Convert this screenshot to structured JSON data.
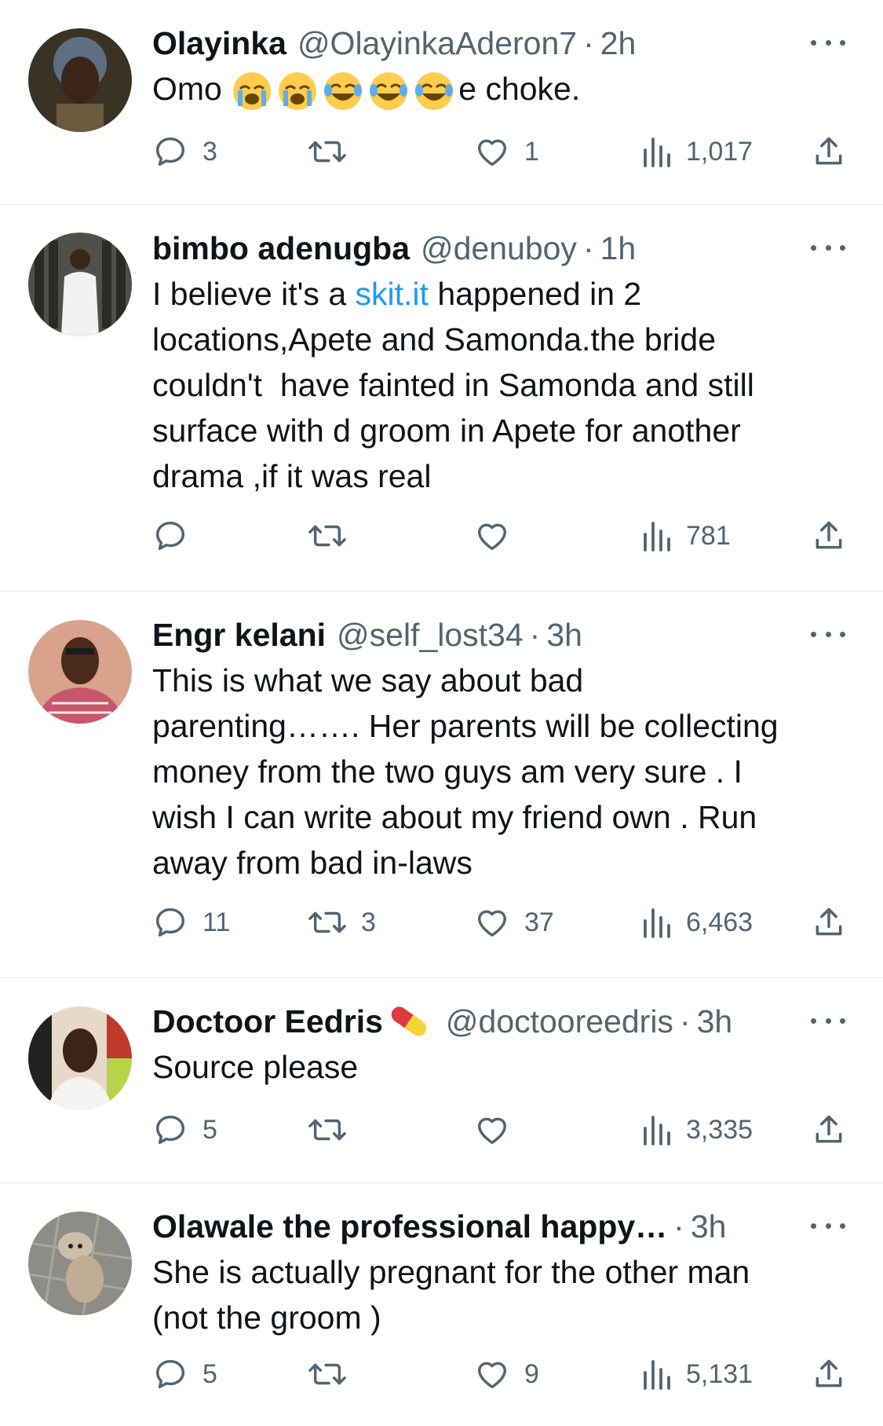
{
  "tweets": [
    {
      "name": "Olayinka",
      "handle": "@OlayinkaAderon7",
      "time": "2h",
      "text_pre": "Omo ",
      "emojis": [
        "loudly-crying-face",
        "loudly-crying-face",
        "face-with-tears-of-joy",
        "face-with-tears-of-joy",
        "face-with-tears-of-joy"
      ],
      "text_post": "e choke.",
      "replies": "3",
      "retweets": "",
      "likes": "1",
      "views": "1,017"
    },
    {
      "name": "bimbo adenugba",
      "handle": "@denuboy",
      "time": "1h",
      "text_pre": "I believe it's a ",
      "link": "skit.it",
      "text_post": " happened in 2\nlocations,Apete and Samonda.the bride\ncouldn't  have fainted in Samonda and still\nsurface with d groom in Apete for another\ndrama ,if it was real",
      "replies": "",
      "retweets": "",
      "likes": "",
      "views": "781"
    },
    {
      "name": "Engr kelani",
      "handle": "@self_lost34",
      "time": "3h",
      "text": "This is what we say about bad\nparenting……. Her parents will be collecting\nmoney from the two guys am very sure . I\nwish I can write about my friend own . Run\naway from bad in-laws",
      "replies": "11",
      "retweets": "3",
      "likes": "37",
      "views": "6,463"
    },
    {
      "name": "Doctoor Eedris",
      "name_emoji": "pill",
      "handle": "@doctooreedris",
      "time": "3h",
      "text": "Source please",
      "replies": "5",
      "retweets": "",
      "likes": "",
      "views": "3,335"
    },
    {
      "name": "Olawale the professional happy…",
      "handle": "",
      "time": "3h",
      "text": "She is actually pregnant for the other man\n(not the groom )",
      "replies": "5",
      "retweets": "",
      "likes": "9",
      "views": "5,131"
    }
  ],
  "colors": {
    "text": "#0f1419",
    "secondary": "#536471",
    "link": "#1d9bf0",
    "divider": "#e6e9ec"
  },
  "separator": "·"
}
